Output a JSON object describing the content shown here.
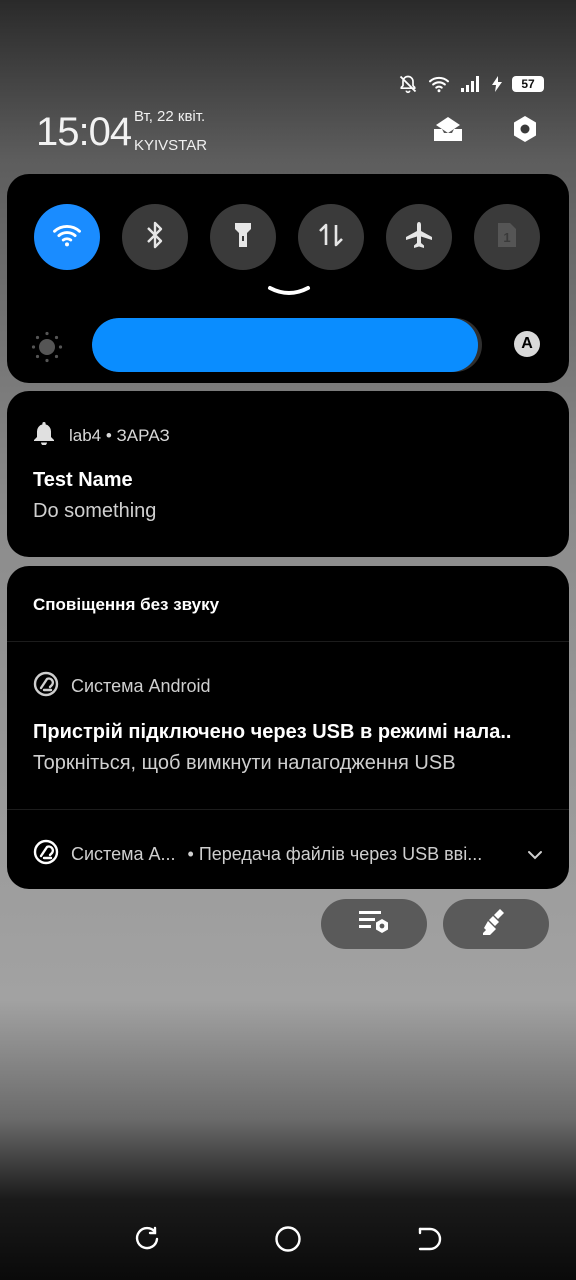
{
  "status_bar": {
    "icons": [
      "notifications-off-icon",
      "wifi-icon",
      "signal-icon",
      "battery-charging-icon"
    ],
    "battery_level": "57"
  },
  "header": {
    "time": "15:04",
    "date": "Вт, 22 квіт.",
    "carrier": "KYIVSTAR",
    "actions": [
      "inbox-icon",
      "settings-icon"
    ]
  },
  "quick_settings": {
    "tiles": [
      {
        "name": "wifi",
        "icon": "wifi-icon",
        "active": true
      },
      {
        "name": "bluetooth",
        "icon": "bluetooth-icon",
        "active": false
      },
      {
        "name": "flashlight",
        "icon": "flashlight-icon",
        "active": false
      },
      {
        "name": "mobile-data",
        "icon": "data-transfer-icon",
        "active": false
      },
      {
        "name": "airplane-mode",
        "icon": "airplane-icon",
        "active": false
      },
      {
        "name": "sim-card",
        "icon": "sim-card-icon",
        "active": false
      }
    ],
    "brightness_fraction": 0.99,
    "auto_brightness_label": "A",
    "accent_color": "#1a8cff"
  },
  "notification_1": {
    "app_line": "lab4 • ЗАРАЗ",
    "title": "Test Name",
    "text": "Do something"
  },
  "silent_section": {
    "header": "Сповіщення без звуку",
    "notification_2": {
      "app": "Система Android",
      "title": "Пристрій підключено через USB в режимі нала..",
      "text": "Торкніться, щоб вимкнути налагодження USB"
    },
    "notification_3": {
      "app": "Система А...",
      "text": "• Передача файлів через USB вві..."
    }
  },
  "actions": {
    "buttons": [
      "notification-settings-icon",
      "clear-all-icon"
    ]
  },
  "nav_bar": {
    "buttons": [
      "recent-apps-icon",
      "home-icon",
      "back-icon"
    ]
  }
}
